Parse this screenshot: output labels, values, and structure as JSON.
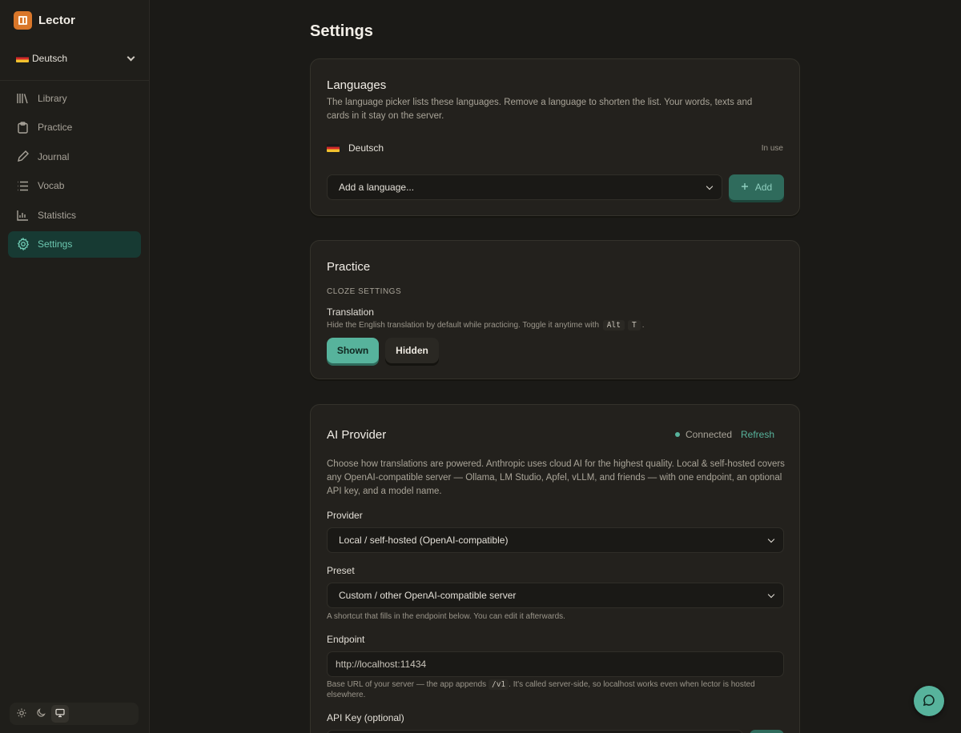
{
  "app": {
    "name": "Lector"
  },
  "sidebar": {
    "language": {
      "name": "Deutsch"
    },
    "items": [
      {
        "label": "Library",
        "icon": "library-icon"
      },
      {
        "label": "Practice",
        "icon": "clipboard-icon"
      },
      {
        "label": "Journal",
        "icon": "pencil-icon"
      },
      {
        "label": "Vocab",
        "icon": "list-icon"
      },
      {
        "label": "Statistics",
        "icon": "chart-icon"
      },
      {
        "label": "Settings",
        "icon": "gear-icon",
        "active": true
      }
    ],
    "theme": {
      "options": [
        "light",
        "dark",
        "system"
      ],
      "selected": "system"
    }
  },
  "page": {
    "title": "Settings"
  },
  "languages": {
    "title": "Languages",
    "description": "The language picker lists these languages. Remove a language to shorten the list. Your words, texts and cards in it stay on the server.",
    "list": [
      {
        "name": "Deutsch",
        "status": "In use"
      }
    ],
    "add_select_placeholder": "Add a language...",
    "add_button": "Add"
  },
  "practice": {
    "title": "Practice",
    "section": "CLOZE SETTINGS",
    "translation_label": "Translation",
    "translation_hint_before": "Hide the English translation by default while practicing. Toggle it anytime with",
    "shortcut_keys": [
      "Alt",
      "T"
    ],
    "translation_hint_after": ".",
    "options": [
      "Shown",
      "Hidden"
    ],
    "selected": "Shown"
  },
  "ai_provider": {
    "title": "AI Provider",
    "status": "Connected",
    "refresh": "Refresh",
    "description": "Choose how translations are powered. Anthropic uses cloud AI for the highest quality. Local & self-hosted covers any OpenAI-compatible server — Ollama, LM Studio, Apfel, vLLM, and friends — with one endpoint, an optional API key, and a model name.",
    "provider_label": "Provider",
    "provider_value": "Local / self-hosted (OpenAI-compatible)",
    "preset_label": "Preset",
    "preset_value": "Custom / other OpenAI-compatible server",
    "preset_hint": "A shortcut that fills in the endpoint below. You can edit it afterwards.",
    "endpoint_label": "Endpoint",
    "endpoint_value": "http://localhost:11434",
    "endpoint_hint_before": "Base URL of your server — the app appends",
    "endpoint_hint_code": "/v1",
    "endpoint_hint_after": ". It's called server-side, so localhost works even when lector is hosted elsewhere.",
    "api_key_label": "API Key (optional)"
  },
  "colors": {
    "accent": "#57b39c",
    "brand": "#d9772a",
    "background": "#1b1a17"
  }
}
